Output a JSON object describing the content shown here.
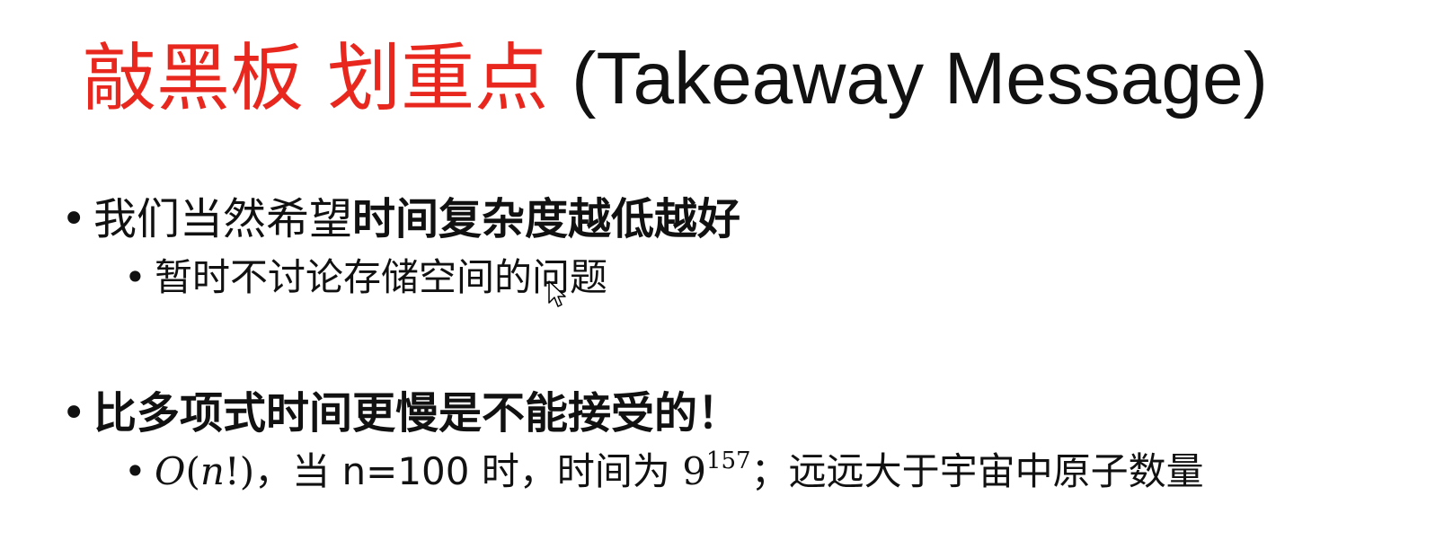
{
  "slide": {
    "title": {
      "red_part": "敲黑板 划重点",
      "black_part": "(Takeaway Message)",
      "red_color": "#e8281e"
    },
    "bullets": [
      {
        "bullet_glyph": "•",
        "text_normal": "我们当然希望",
        "text_bold": "时间复杂度越低越好",
        "sub": {
          "bullet_glyph": "•",
          "text": "暂时不讨论存储空间的问题"
        }
      },
      {
        "bullet_glyph": "•",
        "text_bold": "比多项式时间更慢是不能接受的！",
        "sub": {
          "bullet_glyph": "•",
          "math_O": "O",
          "math_paren_open": "(",
          "math_n": "n",
          "math_excl_close": "!)",
          "text_mid": "，当 n=100 时，时间为 ",
          "math_base": "9",
          "math_exp": "157",
          "text_end": "；远远大于宇宙中原子数量"
        }
      }
    ],
    "cursor_icon": "mouse-pointer-icon"
  }
}
